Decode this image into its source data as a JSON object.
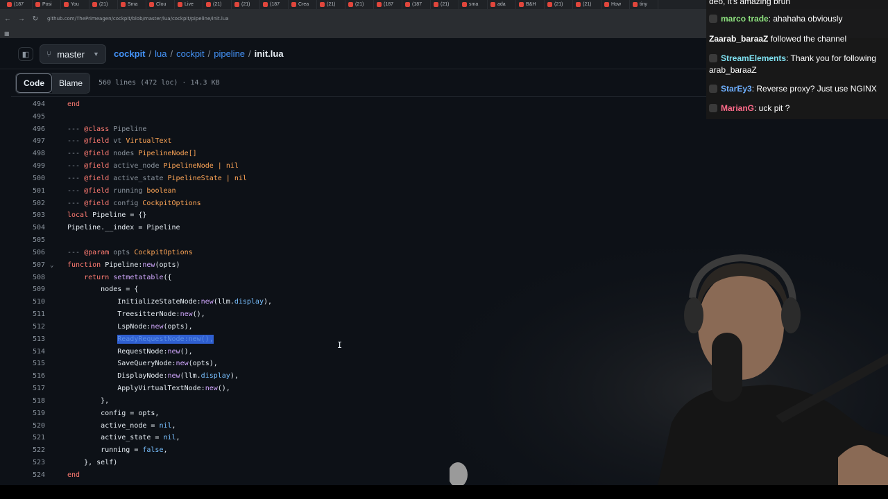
{
  "browser": {
    "tabs": [
      "(187",
      "Posi",
      "You",
      "(21)",
      "Sma",
      "Clou",
      "Live",
      "(21)",
      "(21)",
      "(187",
      "Crea",
      "(21)",
      "(21)",
      "(187",
      "(187",
      "(21)",
      "sma",
      "ada",
      "B&H",
      "(21)",
      "(21)",
      "How",
      "tiny"
    ],
    "url": "github.com/ThePrimeagen/cockpit/blob/master/lua/cockpit/pipeline/init.lua"
  },
  "repo": {
    "branch": "master",
    "breadcrumb": [
      "cockpit",
      "lua",
      "cockpit",
      "pipeline"
    ],
    "file": "init.lua"
  },
  "toolbar": {
    "code_label": "Code",
    "blame_label": "Blame",
    "file_info": "560 lines (472 loc) · 14.3 KB"
  },
  "code_lines": [
    {
      "n": "494",
      "text": "end"
    },
    {
      "n": "495",
      "text": ""
    },
    {
      "n": "496",
      "text": "--- @class Pipeline"
    },
    {
      "n": "497",
      "text": "--- @field vt VirtualText"
    },
    {
      "n": "498",
      "text": "--- @field nodes PipelineNode[]"
    },
    {
      "n": "499",
      "text": "--- @field active_node PipelineNode | nil"
    },
    {
      "n": "500",
      "text": "--- @field active_state PipelineState | nil"
    },
    {
      "n": "501",
      "text": "--- @field running boolean"
    },
    {
      "n": "502",
      "text": "--- @field config CockpitOptions"
    },
    {
      "n": "503",
      "text": "local Pipeline = {}"
    },
    {
      "n": "504",
      "text": "Pipeline.__index = Pipeline"
    },
    {
      "n": "505",
      "text": ""
    },
    {
      "n": "506",
      "text": "--- @param opts CockpitOptions"
    },
    {
      "n": "507",
      "text": "function Pipeline:new(opts)"
    },
    {
      "n": "508",
      "text": "    return setmetatable({"
    },
    {
      "n": "509",
      "text": "        nodes = {"
    },
    {
      "n": "510",
      "text": "            InitializeStateNode:new(llm.display),"
    },
    {
      "n": "511",
      "text": "            TreesitterNode:new(),"
    },
    {
      "n": "512",
      "text": "            LspNode:new(opts),"
    },
    {
      "n": "513",
      "text": "            ReadyRequestNode:new(),"
    },
    {
      "n": "514",
      "text": "            RequestNode:new(),"
    },
    {
      "n": "515",
      "text": "            SaveQueryNode:new(opts),"
    },
    {
      "n": "516",
      "text": "            DisplayNode:new(llm.display),"
    },
    {
      "n": "517",
      "text": "            ApplyVirtualTextNode:new(),"
    },
    {
      "n": "518",
      "text": "        },"
    },
    {
      "n": "519",
      "text": "        config = opts,"
    },
    {
      "n": "520",
      "text": "        active_node = nil,"
    },
    {
      "n": "521",
      "text": "        active_state = nil,"
    },
    {
      "n": "522",
      "text": "        running = false,"
    },
    {
      "n": "523",
      "text": "    }, self)"
    },
    {
      "n": "524",
      "text": "end"
    }
  ],
  "chat": {
    "messages": [
      {
        "user": "",
        "text": "deo, it's amazing brun",
        "color": "#ffffff"
      },
      {
        "user": "marco trade",
        "text": ": ahahaha obviously",
        "color": "#8ee37f"
      },
      {
        "user": "Zaarab_baraaZ",
        "text": " followed the channel",
        "color": "#ffffff"
      },
      {
        "user": "StreamElements",
        "text": ": Thank you for following",
        "color": "#7ee0f0"
      },
      {
        "user": "",
        "text": "arab_baraaZ",
        "color": "#ffffff"
      },
      {
        "user": "StarEy3",
        "text": ": Reverse proxy? Just use NGINX",
        "color": "#6fb0ff"
      },
      {
        "user": "MarianG",
        "text": ": uck pit ?",
        "color": "#ff6b8a"
      }
    ]
  },
  "colors": {
    "background": "#0d1117",
    "link": "#4493f8",
    "selection": "#2f5fd0"
  }
}
